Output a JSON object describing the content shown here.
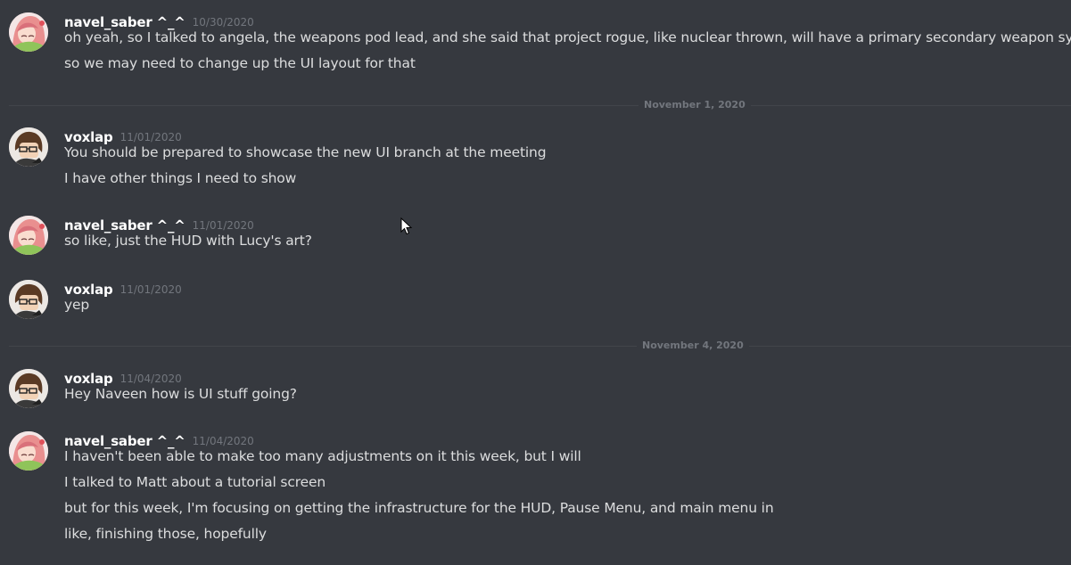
{
  "messages": [
    {
      "username": "navel_saber ^_^",
      "timestamp": "10/30/2020",
      "lines": [
        "oh yeah, so I talked to angela, the weapons pod lead, and she said that project rogue, like nuclear thrown, will have a primary secondary weapon system",
        "so we may need to change up the UI layout for that"
      ]
    },
    {
      "username": "voxlap",
      "timestamp": "11/01/2020",
      "lines": [
        "You should be prepared to showcase the new UI branch at the meeting",
        "I have other things I need to show"
      ]
    },
    {
      "username": "navel_saber ^_^",
      "timestamp": "11/01/2020",
      "lines": [
        "so like, just the HUD with Lucy's art?"
      ]
    },
    {
      "username": "voxlap",
      "timestamp": "11/01/2020",
      "lines": [
        "yep"
      ]
    },
    {
      "username": "voxlap",
      "timestamp": "11/04/2020",
      "lines": [
        "Hey Naveen how is UI stuff going?"
      ]
    },
    {
      "username": "navel_saber ^_^",
      "timestamp": "11/04/2020",
      "lines": [
        "I haven't been able to make too many adjustments on it this week, but I will",
        "I talked to Matt about a tutorial screen",
        "but for this week, I'm focusing on getting the infrastructure for the HUD, Pause Menu, and main menu in",
        "like, finishing those, hopefully"
      ]
    }
  ],
  "dividers": [
    {
      "label": "November 1, 2020"
    },
    {
      "label": "November 4, 2020"
    }
  ],
  "colors": {
    "background": "#36393f",
    "username": "#ffffff",
    "message_text": "#dcddde",
    "timestamp": "#72767d",
    "divider_line": "#42454a"
  }
}
